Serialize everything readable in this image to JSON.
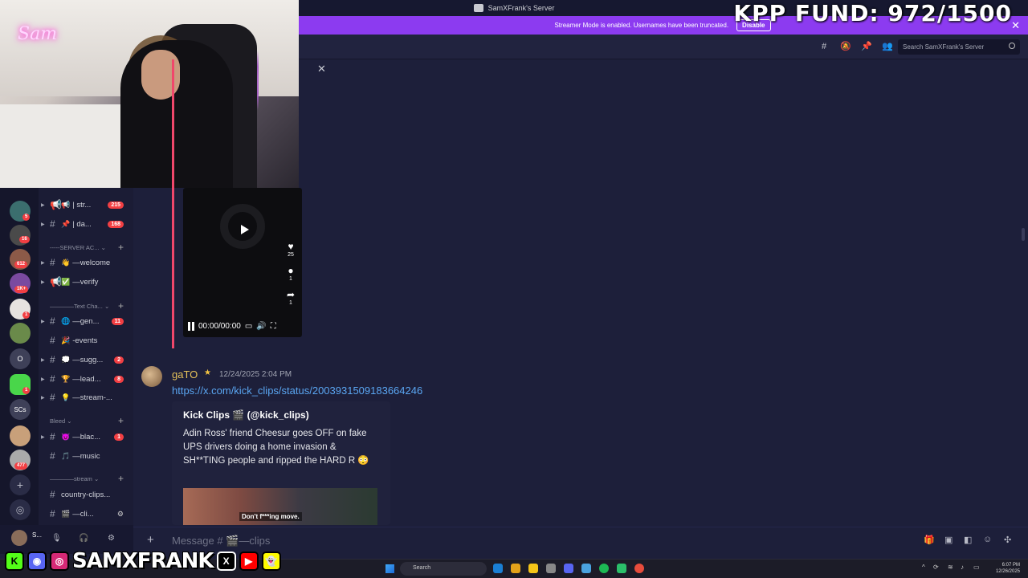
{
  "window": {
    "title": "SamXFrank's Server"
  },
  "banner": {
    "text": "Streamer Mode is enabled. Usernames have been truncated.",
    "button": "Disable"
  },
  "overlay": {
    "fund": "KPP FUND: 972/1500",
    "channel_name": "SAMXFRANK",
    "neon_sign": "Sam"
  },
  "header": {
    "search_placeholder": "Search SamXFrank's Server"
  },
  "servers": [
    {
      "badge": "5"
    },
    {
      "badge": "16"
    },
    {
      "badge": "612"
    },
    {
      "badge": "1K+"
    },
    {
      "badge": "1"
    },
    {
      "badge": ""
    },
    {
      "label": "O"
    },
    {
      "badge": "1"
    },
    {
      "label": "SCs"
    },
    {
      "badge": ""
    },
    {
      "badge": "477"
    }
  ],
  "channels": {
    "items": [
      {
        "name": "| str...",
        "emoji": "📢",
        "count": "215",
        "type": "announce"
      },
      {
        "name": "| da...",
        "emoji": "📌",
        "count": "168",
        "type": "text"
      },
      {
        "name": "—welcome",
        "emoji": "👋",
        "count": "",
        "type": "text"
      },
      {
        "name": "—verify",
        "emoji": "✅",
        "count": "",
        "type": "announce"
      },
      {
        "name": "—gen...",
        "emoji": "🌐",
        "count": "11",
        "type": "text"
      },
      {
        "name": "-events",
        "emoji": "🎉",
        "count": "",
        "type": "text"
      },
      {
        "name": "—sugg...",
        "emoji": "💭",
        "count": "2",
        "type": "text"
      },
      {
        "name": "—lead...",
        "emoji": "🏆",
        "count": "8",
        "type": "text"
      },
      {
        "name": "—stream-...",
        "emoji": "💡",
        "count": "",
        "type": "text"
      },
      {
        "name": "—blac...",
        "emoji": "😈",
        "count": "1",
        "type": "text"
      },
      {
        "name": "—music",
        "emoji": "🎵",
        "count": "",
        "type": "text"
      },
      {
        "name": "country-clips...",
        "emoji": "",
        "count": "",
        "type": "text"
      },
      {
        "name": "—cli...",
        "emoji": "🎬",
        "count": "",
        "type": "text"
      }
    ],
    "categories": [
      "-----SERVER AC...",
      "————Text Cha...",
      "Bleed",
      "————stream"
    ]
  },
  "user": {
    "name": "S..."
  },
  "video": {
    "likes": "25",
    "comments": "1",
    "shares": "1",
    "time": "00:00/00:00"
  },
  "message": {
    "author": "gaTO",
    "timestamp": "12/24/2025 2:04 PM",
    "link": "https://x.com/kick_clips/status/2003931509183664246",
    "embed_author": "Kick Clips 🎬 (@kick_clips)",
    "embed_body": "Adin Ross' friend Cheesur goes OFF on fake UPS drivers doing a home invasion & SH**TING people and ripped the HARD R 😳",
    "thumb_caption": "Don't f***ing move."
  },
  "composer": {
    "placeholder": "Message # 🎬—clips"
  },
  "taskbar": {
    "search": "Search",
    "time": "6:07 PM",
    "date": "12/26/2025"
  },
  "colors": {
    "banner": "#8c3bf0",
    "badge": "#f23f43",
    "link": "#5aa6f2",
    "author": "#e6c25a",
    "unread_bar": "#f0476b"
  }
}
